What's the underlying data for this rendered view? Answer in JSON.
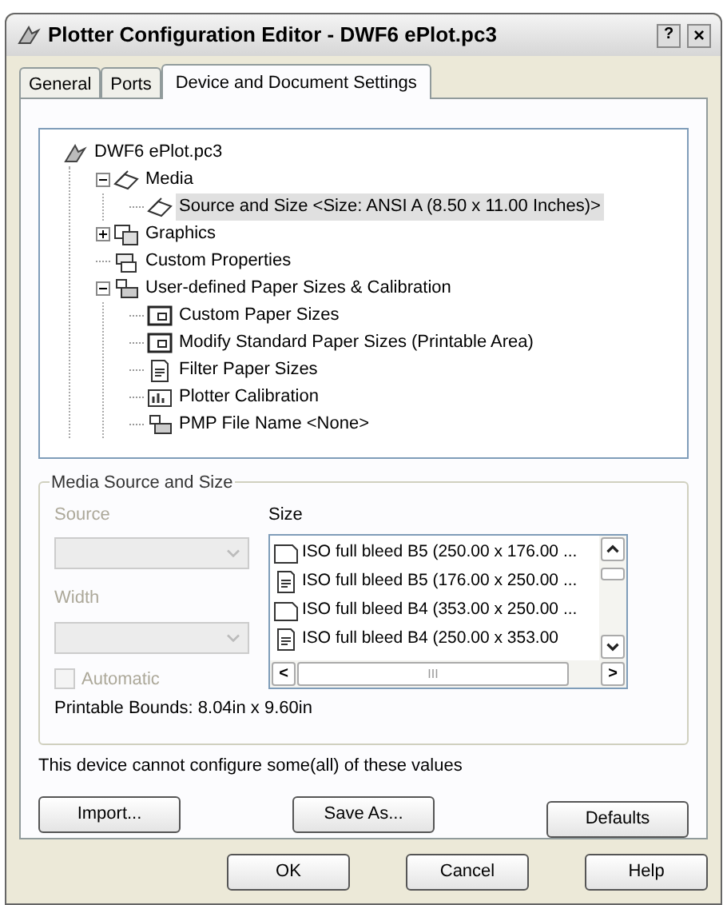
{
  "window": {
    "title": "Plotter Configuration Editor - DWF6 ePlot.pc3",
    "help_glyph": "?",
    "close_glyph": "×"
  },
  "tabs": [
    {
      "label": "General",
      "selected": false
    },
    {
      "label": "Ports",
      "selected": false
    },
    {
      "label": "Device and Document Settings",
      "selected": true
    }
  ],
  "tree": [
    {
      "label": "DWF6 ePlot.pc3",
      "kind": "plotter",
      "selected": false,
      "children": [
        {
          "label": "Media",
          "kind": "media",
          "expanded": true,
          "selected": false,
          "children": [
            {
              "label": "Source and Size <Size: ANSI A (8.50 x 11.00 Inches)>",
              "kind": "media",
              "selected": true
            }
          ]
        },
        {
          "label": "Graphics",
          "kind": "graphics",
          "expanded": false,
          "selected": false
        },
        {
          "label": "Custom Properties",
          "kind": "properties",
          "selected": false
        },
        {
          "label": "User-defined Paper Sizes & Calibration",
          "kind": "paper",
          "expanded": true,
          "selected": false,
          "children": [
            {
              "label": "Custom Paper Sizes",
              "kind": "sheet",
              "selected": false
            },
            {
              "label": "Modify Standard Paper Sizes (Printable Area)",
              "kind": "sheet",
              "selected": false
            },
            {
              "label": "Filter Paper Sizes",
              "kind": "doc",
              "selected": false
            },
            {
              "label": "Plotter Calibration",
              "kind": "calibration",
              "selected": false
            },
            {
              "label": "PMP File Name <None>",
              "kind": "paper",
              "selected": false
            }
          ]
        }
      ]
    }
  ],
  "media_group": {
    "title": "Media Source and Size",
    "source": {
      "label": "Source",
      "disabled": true
    },
    "width": {
      "label": "Width",
      "disabled": true
    },
    "automatic": {
      "label": "Automatic",
      "checked": false,
      "disabled": true
    },
    "size_label": "Size",
    "sizes": [
      {
        "label": "ISO full bleed B5 (250.00 x 176.00 ...",
        "kind": "landscape",
        "selected": false
      },
      {
        "label": "ISO full bleed B5 (176.00 x 250.00 ...",
        "kind": "portrait",
        "selected": false
      },
      {
        "label": "ISO full bleed B4 (353.00 x 250.00 ...",
        "kind": "landscape",
        "selected": false
      },
      {
        "label": "ISO full bleed B4 (250.00 x 353.00",
        "kind": "portrait",
        "selected": false
      }
    ],
    "scroll_left": "<",
    "scroll_right": ">",
    "scroll_grip": "III",
    "printable_bounds": "Printable Bounds: 8.04in x 9.60in"
  },
  "note": "This device cannot configure some(all) of these values",
  "panel_buttons": [
    "Import...",
    "Save As...",
    "Defaults"
  ],
  "dialog_buttons": [
    "OK",
    "Cancel",
    "Help"
  ]
}
